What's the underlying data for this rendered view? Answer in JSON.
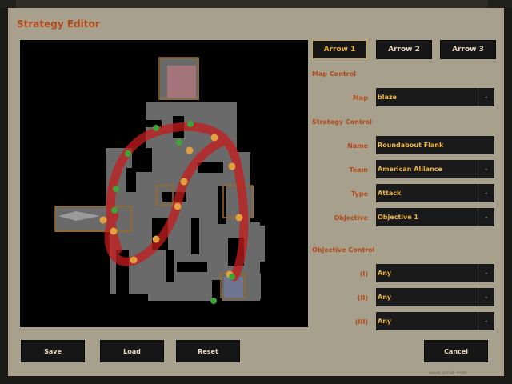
{
  "window": {
    "title": "Strategy Editor"
  },
  "arrows": [
    {
      "label": "Arrow 1",
      "active": true
    },
    {
      "label": "Arrow 2",
      "active": false
    },
    {
      "label": "Arrow 3",
      "active": false
    }
  ],
  "sections": {
    "map_control": "Map Control",
    "strategy_control": "Strategy Control",
    "objective_control": "Objective Control"
  },
  "fields": {
    "map": {
      "label": "Map",
      "value": "blaze",
      "dropdown": "-"
    },
    "name": {
      "label": "Name",
      "value": "Roundabout Flank"
    },
    "team": {
      "label": "Team",
      "value": "American Alliance",
      "dropdown": "-"
    },
    "type": {
      "label": "Type",
      "value": "Attack",
      "dropdown": "-"
    },
    "objective": {
      "label": "Objective",
      "value": "Objective 1",
      "dropdown": "-"
    },
    "obj_1": {
      "label": "(I)",
      "value": "Any",
      "dropdown": "-"
    },
    "obj_2": {
      "label": "(II)",
      "value": "Any",
      "dropdown": "-"
    },
    "obj_3": {
      "label": "(III)",
      "value": "Any",
      "dropdown": "-"
    }
  },
  "buttons": {
    "save": "Save",
    "load": "Load",
    "reset": "Reset",
    "cancel": "Cancel"
  },
  "watermark": "www.acnet.com",
  "colors": {
    "window_bg": "#a7a08d",
    "title": "#b54a1a",
    "field_value": "#e9b342",
    "path_arrow": "#c41c1c",
    "waypoint": "#e2a13c",
    "waypoint_green": "#3fa537"
  }
}
